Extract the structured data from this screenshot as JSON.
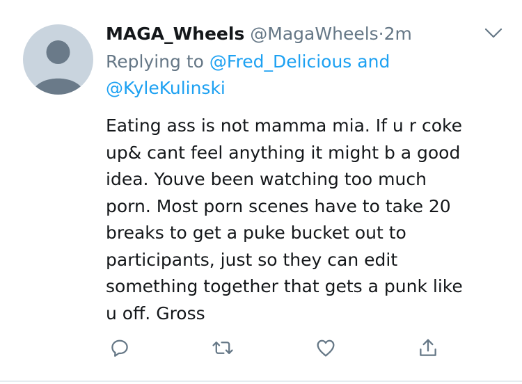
{
  "tweet": {
    "display_name": "MAGA_Wheels",
    "handle": "@MagaWheels",
    "separator": "·",
    "time": "2m",
    "reply_prefix": "Replying to",
    "mention_1": "@Fred_Delicious",
    "reply_and": "and",
    "mention_2": "@KyleKulinski",
    "text": "Eating ass is not mamma mia. If u r coke\nup& cant feel anything it might b a good\nidea. Youve been watching too much\nporn. Most porn scenes have to take 20\nbreaks to get a puke bucket out to\nparticipants, just so they can edit\nsomething together that gets a punk like\nu off. Gross"
  },
  "icons": {
    "avatar": "default-avatar-icon",
    "menu": "chevron-down-icon",
    "reply": "reply-icon",
    "retweet": "retweet-icon",
    "like": "heart-icon",
    "share": "share-icon"
  },
  "colors": {
    "text": "#14171a",
    "secondary": "#657786",
    "link": "#1da1f2",
    "avatar_bg": "#c9d4de",
    "avatar_figure": "#6a7a89",
    "icon": "#657786"
  }
}
